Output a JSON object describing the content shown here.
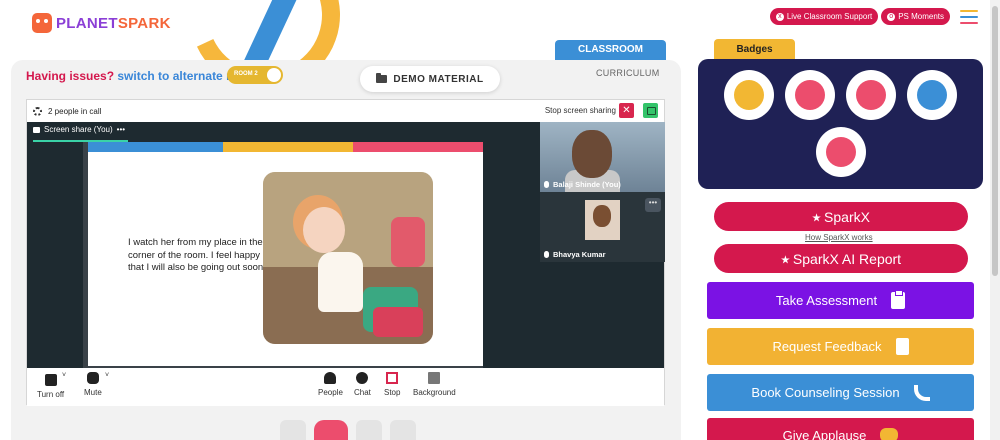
{
  "brand": {
    "logo_part1": "PLANET",
    "logo_part2": "SPARK"
  },
  "header": {
    "live_support": "Live Classroom Support",
    "ps_moments": "PS Moments"
  },
  "colors": {
    "accent_red": "#d4184d",
    "accent_blue": "#3b8fd6",
    "accent_yellow": "#f2b733",
    "accent_purple": "#7b12e4",
    "hamburger": [
      "#f2b733",
      "#3b8fd6",
      "#ec4d6d"
    ]
  },
  "issues": {
    "question": "Having issues?",
    "switch_text": "switch to alternate room",
    "room_label": "ROOM 2"
  },
  "demo_material": "DEMO MATERIAL",
  "tabs": {
    "classroom": "CLASSROOM",
    "curriculum": "CURRICULUM"
  },
  "call": {
    "people_count": "2 people in call",
    "stop_sharing": "Stop screen sharing",
    "screen_share_tab": "Screen share (You)",
    "screen_share_more": "•••",
    "close_glyph": "✕",
    "participants": [
      {
        "name": "Balaji Shinde (You)"
      },
      {
        "name": "Bhavya Kumar"
      }
    ],
    "more_glyph": "•••",
    "slide_text": "I watch her from my place in the corner of the room. I feel happy that I will also be going out soon.",
    "controls": {
      "turn_off": "Turn off",
      "mute": "Mute",
      "people": "People",
      "chat": "Chat",
      "stop": "Stop",
      "background": "Background",
      "caret": "˅"
    }
  },
  "badges": {
    "title": "Badges",
    "items": [
      {
        "icon": "trophy-badge-icon",
        "color": "#f2b733"
      },
      {
        "icon": "hand-badge-icon",
        "color": "#ec4d6d"
      },
      {
        "icon": "meditation-badge-icon",
        "color": "#ec4d6d"
      },
      {
        "icon": "bulb-badge-icon",
        "color": "#3b8fd6"
      },
      {
        "icon": "face-badge-icon",
        "color": "#ec4d6d"
      }
    ]
  },
  "actions": {
    "sparkx": "SparkX",
    "how_sparkx": "How SparkX works",
    "sparkx_ai": "SparkX AI Report",
    "take_assessment": "Take Assessment",
    "request_feedback": "Request Feedback",
    "book_counseling": "Book Counseling Session",
    "give_applause": "Give Applause"
  }
}
